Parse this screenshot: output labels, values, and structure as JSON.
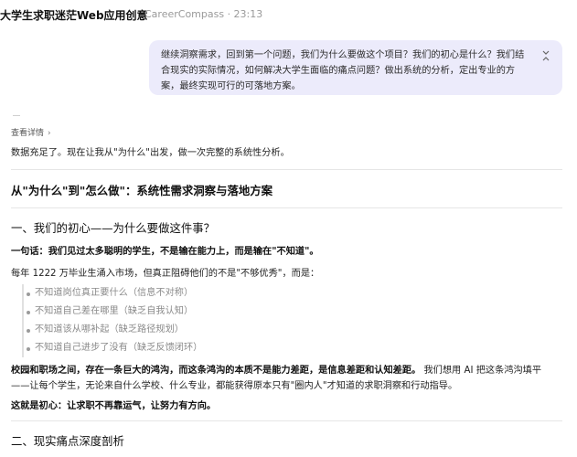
{
  "header": {
    "title": "大学生求职迷茫Web应用创意",
    "meta": "CareerCompass · 23:13"
  },
  "user_message": {
    "text": "继续洞察需求，回到第一个问题，我们为什么要做这个项目？我们的初心是什么？我们结合现实的实际情况，如何解决大学生面临的痛点问题？做出系统的分析，定出专业的方案，最终实现可行的可落地方案。",
    "collapse_icon": "chevrons-collapse-icon"
  },
  "response": {
    "details_label": "查看详情",
    "details_icon": "chevron-right-icon",
    "intro": "数据充足了。现在让我从\"为什么\"出发，做一次完整的系统性分析。",
    "main_heading": "从\"为什么\"到\"怎么做\"：系统性需求洞察与落地方案",
    "section1_heading": "一、我们的初心——为什么要做这件事？",
    "one_liner": "一句话：我们见过太多聪明的学生，不是输在能力上，而是输在\"不知道\"。",
    "stat_line": "每年 1222 万毕业生涌入市场，但真正阻碍他们的不是\"不够优秀\"，而是：",
    "list": [
      "不知道岗位真正要什么（信息不对称）",
      "不知道自己差在哪里（缺乏自我认知）",
      "不知道该从哪补起（缺乏路径规划）",
      "不知道自己进步了没有（缺乏反馈闭环）"
    ],
    "para_bold": "校园和职场之间，存在一条巨大的鸿沟，而这条鸿沟的本质不是能力差距，是信息差距和认知差距。",
    "para_rest": "我们想用 AI 把这条鸿沟填平——让每个学生，无论来自什么学校、什么专业，都能获得原本只有\"圈内人\"才知道的求职洞察和行动指导。",
    "conclusion": "这就是初心：让求职不再靠运气，让努力有方向。",
    "section2_heading": "二、现实痛点深度剖析"
  }
}
